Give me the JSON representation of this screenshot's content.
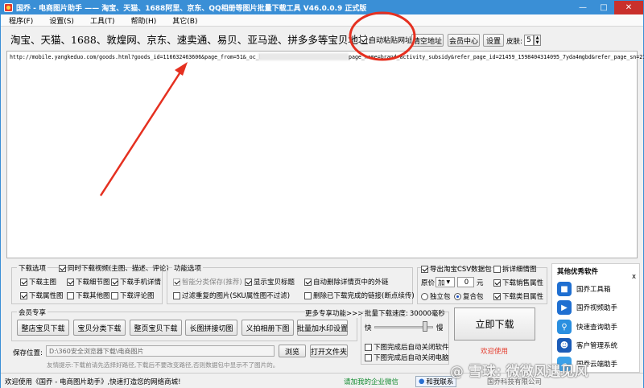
{
  "window": {
    "title": "国乔 - 电商图片助手 —— 淘宝、天猫、1688阿里、京东、QQ相册等图片批量下载工具 V46.0.0.9 正式版"
  },
  "menu": [
    "程序(F)",
    "设置(S)",
    "工具(T)",
    "帮助(H)",
    "其它(B)"
  ],
  "url_bar": {
    "label": "淘宝、天猫、1688、敦煌网、京东、速卖通、易贝、亚马逊、拼多多等宝贝地址:",
    "auto_paste_label": "自动粘贴网址",
    "clear_label": "清空地址",
    "member_label": "会员中心",
    "settings_label": "设置",
    "skin_label": "皮肤:",
    "skin_value": "5"
  },
  "url_text": {
    "left": "http://mobile.yangkeduo.com/goods.html?goods_id=116632463606&page_from=51&_oc_b",
    "right": "page_name=brand_activity_subsidy&refer_page_id=21459_1598404314095_7yda4mgbd&refer_page_sn=21"
  },
  "download_options": {
    "legend": "下载选项",
    "video_label": "同时下载视频(主图、描述、评论)",
    "items": [
      "下载主图",
      "下载细节图",
      "下载手机详情",
      "下载属性图",
      "下载其他图",
      "下载评论图"
    ]
  },
  "function_options": {
    "legend": "功能选项",
    "smart_label": "智能分类保存(推荐)",
    "show_title_label": "显示宝贝标题",
    "auto_delete_label": "自动删除详情页中的外链",
    "filter_label": "过滤重复的图片(SKU属性图不过滤)",
    "delete_downloaded_label": "删除已下载完成的链接(断点续传)"
  },
  "csv": {
    "export_label": "导出淘宝CSV数据包",
    "details_label": "拆详细情图",
    "price_label": "原价",
    "price_op": "加",
    "price_value": "0",
    "yuan": "元",
    "sales_attr_label": "下载销售属性",
    "single_label": "独立包",
    "combined_label": "复合包",
    "cat_attr_label": "下载类目属性"
  },
  "member": {
    "legend": "会员专享",
    "more_label": "更多专享功能>>>",
    "buttons": [
      "整店宝贝下载",
      "宝贝分类下载",
      "整页宝贝下载",
      "长图拼接切图",
      "义拍相册下图",
      "批量加水印设置"
    ]
  },
  "speed": {
    "legend": "批量下载速度:",
    "value": "30000毫秒",
    "fast": "快",
    "slow": "慢",
    "fraction": 0.9,
    "close_software_label": "下图完成后自动关闭软件",
    "shutdown_label": "下图完成后自动关闭电脑"
  },
  "download_button": "立即下载",
  "welcome_use": "欢迎使用",
  "save": {
    "label": "保存位置:",
    "path": "D:\\360安全浏览器下载\\电商图片",
    "browse_label": "浏览",
    "open_label": "打开文件夹",
    "tip": "友情提示:下载前请先选择好路径,下载后不要改变路径,否则数据包中显示不了图片的。"
  },
  "sidebar": {
    "title": "其他优秀软件",
    "close": "x",
    "items": [
      "国乔工具箱",
      "国乔视频助手",
      "快速查询助手",
      "客户管理系统",
      "国乔云端助手"
    ]
  },
  "status": {
    "welcome": "欢迎使用《国乔 - 电商图片助手》,快速打造您的网络商城!",
    "wechat": "请加我的企业微信",
    "contact": "和我联系",
    "company": "国乔科技有限公司"
  },
  "watermark": "@ 雪球: 微微风遇见风",
  "colors": {
    "titlebar": "#3a8fd6",
    "close": "#c9302c",
    "annotation": "#e53020",
    "welcome": "#e53b2c",
    "wechat": "#108a2e"
  }
}
